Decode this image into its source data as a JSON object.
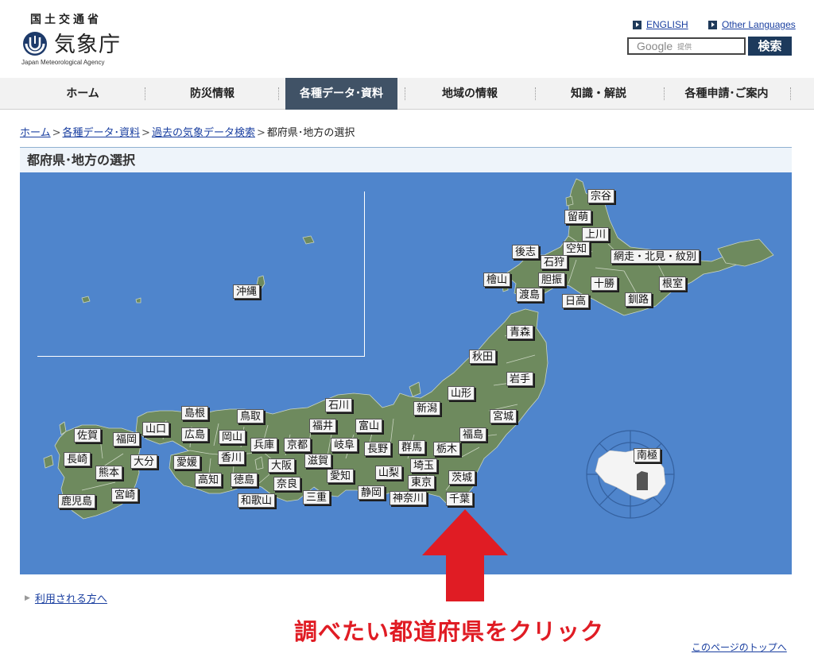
{
  "header": {
    "ministry": "国土交通省",
    "agency_name": "気象庁",
    "agency_en": "Japan Meteorological Agency",
    "links": {
      "english": "ENGLISH",
      "other": "Other Languages"
    },
    "search": {
      "brand": "Google",
      "provided": "提供",
      "button": "検索"
    }
  },
  "nav": {
    "items": [
      {
        "label": "ホーム"
      },
      {
        "label": "防災情報"
      },
      {
        "label": "各種データ･資料"
      },
      {
        "label": "地域の情報"
      },
      {
        "label": "知識・解説"
      },
      {
        "label": "各種申請･ご案内"
      }
    ],
    "active_index": 2
  },
  "breadcrumb": {
    "items": [
      "ホーム",
      "各種データ･資料",
      "過去の気象データ検索"
    ],
    "current": "都府県･地方の選択"
  },
  "section_title": "都府県･地方の選択",
  "map": {
    "prefectures": {
      "soya": "宗谷",
      "rumoi": "留萌",
      "kamikawa": "上川",
      "shiribeshi": "後志",
      "sorachi": "空知",
      "ishikari": "石狩",
      "abashiri": "網走・北見・紋別",
      "hiyama": "檜山",
      "iburi": "胆振",
      "tokachi": "十勝",
      "nemuro": "根室",
      "oshima": "渡島",
      "hidaka": "日高",
      "kushiro": "釧路",
      "aomori": "青森",
      "akita": "秋田",
      "iwate": "岩手",
      "yamagata": "山形",
      "miyagi": "宮城",
      "niigata": "新潟",
      "fukushima": "福島",
      "ishikawa": "石川",
      "fukui": "福井",
      "toyama": "富山",
      "gunma": "群馬",
      "tochigi": "栃木",
      "nagano": "長野",
      "gifu": "岐阜",
      "saitama": "埼玉",
      "ibaraki": "茨城",
      "yamanashi": "山梨",
      "tokyo": "東京",
      "kanagawa": "神奈川",
      "chiba": "千葉",
      "shizuoka": "静岡",
      "aichi": "愛知",
      "shiga": "滋賀",
      "kyoto": "京都",
      "mie": "三重",
      "osaka": "大阪",
      "nara": "奈良",
      "wakayama": "和歌山",
      "hyogo": "兵庫",
      "tottori": "鳥取",
      "shimane": "島根",
      "okayama": "岡山",
      "hiroshima": "広島",
      "yamaguchi": "山口",
      "kagawa": "香川",
      "tokushima": "徳島",
      "ehime": "愛媛",
      "kochi": "高知",
      "fukuoka": "福岡",
      "saga": "佐賀",
      "nagasaki": "長崎",
      "oita": "大分",
      "kumamoto": "熊本",
      "miyazaki": "宮崎",
      "kagoshima": "鹿児島",
      "okinawa": "沖縄",
      "antarctica": "南極"
    }
  },
  "user_link": "利用される方へ",
  "instruction": "調べたい都道府県をクリック",
  "page_top": "このページのトップへ",
  "colors": {
    "accent_red": "#e01c24",
    "nav_active": "#405266",
    "sea": "#4f85cc",
    "land": "#6e8a5e",
    "link": "#1a3fa0"
  }
}
